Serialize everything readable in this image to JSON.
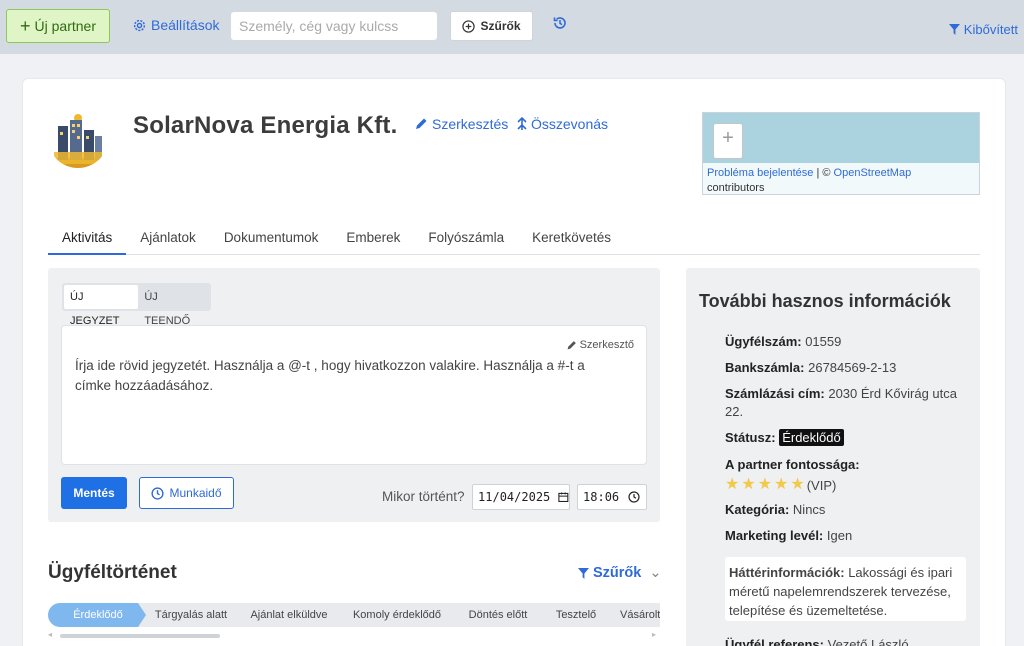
{
  "topbar": {
    "new_partner": "Új partner",
    "settings": "Beállítások",
    "search_placeholder": "Személy, cég vagy kulcss",
    "filters": "Szűrők",
    "expanded": "Kibővített"
  },
  "company": {
    "name": "SolarNova Energia Kft.",
    "edit": "Szerkesztés",
    "merge": "Összevonás"
  },
  "map": {
    "zoom_in": "+",
    "report": "Probléma bejelentése",
    "separator": " | © ",
    "osm": "OpenStreetMap",
    "contributors": "contributors"
  },
  "tabs": [
    {
      "label": "Aktivitás",
      "active": true
    },
    {
      "label": "Ajánlatok",
      "active": false
    },
    {
      "label": "Dokumentumok",
      "active": false
    },
    {
      "label": "Emberek",
      "active": false
    },
    {
      "label": "Folyószámla",
      "active": false
    },
    {
      "label": "Keretkövetés",
      "active": false
    }
  ],
  "note": {
    "tab_note": "ÚJ JEGYZET",
    "tab_todo": "ÚJ TEENDŐ",
    "editor": "Szerkesztő",
    "placeholder": "Írja ide rövid jegyzetét. Használja a @-t , hogy hivatkozzon valakire. Használja a #-t a címke hozzáadásához.",
    "save": "Mentés",
    "worktime": "Munkaidő",
    "when_label": "Mikor történt?",
    "date_month": "11",
    "date_day": "04",
    "date_year": "2025",
    "time_hour": "18",
    "time_min": "06"
  },
  "history": {
    "title": "Ügyféltörténet",
    "filters": "Szűrők",
    "stages": [
      "Érdeklődő",
      "Tárgyalás alatt",
      "Ajánlat elküldve",
      "Komoly érdeklődő",
      "Döntés előtt",
      "Tesztelő",
      "Vásárolt"
    ],
    "active_stage": "Érdeklődő"
  },
  "info": {
    "title": "További hasznos információk",
    "client_no_label": "Ügyfélszám:",
    "client_no": "01559",
    "bank_label": "Bankszámla:",
    "bank": "26784569-2-13",
    "billing_label": "Számlázási cím:",
    "billing": "2030 Érd Kővirág utca 22.",
    "status_label": "Státusz:",
    "status": "Érdeklődő",
    "importance_label": "A partner fontossága:",
    "importance_stars": 5,
    "importance_text": "(VIP)",
    "category_label": "Kategória:",
    "category": "Nincs",
    "marketing_label": "Marketing levél:",
    "marketing": "Igen",
    "background_label": "Háttérinformációk:",
    "background": "Lakossági és ipari méretű napelemrendszerek tervezése, telepítése és üzemeltetése.",
    "reference_label": "Ügyfél referens:",
    "reference": "Vezető László"
  },
  "colors": {
    "accent": "#2f6bd8",
    "primary_button": "#1f6fe5",
    "new_button_bg": "#dff5c5",
    "active_stage": "#7fb8ef",
    "star": "#f3c84b"
  }
}
